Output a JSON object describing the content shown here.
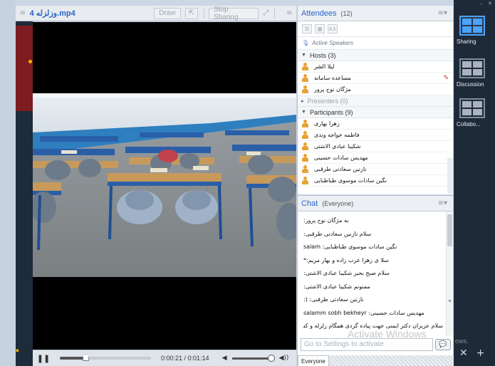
{
  "video": {
    "filename": "ﻭﺯﻟﺰﻟﻪ 4.mp4",
    "draw_label": "Draw",
    "stop_sharing_label": "Stop Sharing",
    "menu_icon": "menu-icon",
    "cursor_icon": "cursor-icon",
    "fullscreen_icon": "fullscreen-icon"
  },
  "player": {
    "current_time": "0:00:21",
    "duration": "0:01:14",
    "time_text": "0:00:21 / 0:01:14",
    "progress_fraction": 0.28
  },
  "attendees": {
    "title": "Attendees",
    "count": "(12)",
    "active_speakers_label": "Active Speakers",
    "hosts_label": "Hosts (3)",
    "hosts": [
      "ﻟﯿﻼ ﺍﻟﺸﺮ",
      "ﻣﺴﺎﻋﺪﻩ ﺳﺎﻣﺎﻧﻪ",
      "ﻣﮋﮔﺎﻥ ﻧﻮﺡ ﭘﺮﻭﺭ"
    ],
    "presenters_label": "Presenters (0)",
    "participants_label": "Participants (9)",
    "participants": [
      "ﺯﻫﺮﺍ ﺑﻬﺎﺭﯼ",
      "ﻓﺎﻃﻤﻪ ﺧﻮﺍﺟﻪ ﻭﻧﺪﯼ",
      "ﺷﮑﯿﺒﺎ ﻋﺒﺎﺩﯼ ﺍﻻﺷﺘﯽ",
      "ﻣﻬﺪﯾﺲ ﺳﺎﺩﺍﺕ ﺣﺴﯿﻨﯽ",
      "ﻧﺎﺯﻧﯿﻦ ﺳﻌﺎﺩﺗﯽ ﻃﺮﻗﺒﻰ",
      "ﻧﮕﯿﻦ ﺳﺎﺩﺍﺕ ﻣﻮﺳﻮﯼ ﻃﺒﺎﻃﺒﺎﯾﯽ"
    ]
  },
  "chat": {
    "title": "Chat",
    "scope": "(Everyone)",
    "messages": [
      "ﺑﻪ ﻣﮋﮔﺎﻥ ﻧﻮﺡ ﭘﺮﻭﺭ:",
      "ﺳﻼﻡ ﻧﺎﺯﻧﯿﻦ ﺳﻌﺎﺩﺗﯽ ﻃﺮﻗﺒﻰ:",
      "ﻧﮕﯿﻦ ﺳﺎﺩﺍﺕ ﻣﻮﺳﻮﯼ ﻃﺒﺎﻃﺒﺎﯾﯽ: salam",
      "ﺳﻼ ﯼ ﺯﻫﺮﺍ ﻋﺮﺏ ﺯﺍﺩﻩ ﻭ ﺑﻬﺎﺭ ﻣﺮﯾﻢ:*",
      "ﺳﻼﻡ ﺻﺒﺢ ﺑﺨﯿﺮ ﺷﮑﯿﺒﺎ ﻋﺒﺎﺩﯼ ﺍﻻﺷﺘﯽ:",
      "ﻣﻤﻨﻮﻧﻢ ﺷﮑﯿﺒﺎ ﻋﺒﺎﺩﯼ ﺍﻻﺷﺘﯽ:",
      "ﻧﺎﺯﻧﯿﻦ ﺳﻌﺎﺩﺗﯽ ﻃﺮﻗﺒﻰ: (:",
      "ﻣﻬﺪﯾﺲ ﺳﺎﺩﺍﺕ ﺣﺴﯿﻨﯽ: salamm sobh bekheyr",
      "ﺳﻼﻡ ﻋﺰﯾﺰﺍﻥ ﺩﮐﺘﺮ ﺍﯾﻤﻨﯽ ﺟﻬﺖ ﭘﯿﺎﺩﻩ ﮔﺮﺩﯼ ﻫﻤﮕﺎﻡ ﺯﻟﺰﻟﻪ ﻭ ﮐﺸﻮﺭ ﺳﻠﯿﻤﺎﻧﯽ:"
    ],
    "input_placeholder": "Go to Settings to activate",
    "tab_label": "Everyone",
    "watermark": "Activate Windows"
  },
  "dock": {
    "items": [
      "Sharing",
      "Discussion",
      "Collabo..."
    ],
    "ows_text": "ows."
  },
  "colors": {
    "accent": "#2a64c8",
    "dock_bg": "#1f2a38",
    "dock_active": "#4aa3ff"
  }
}
